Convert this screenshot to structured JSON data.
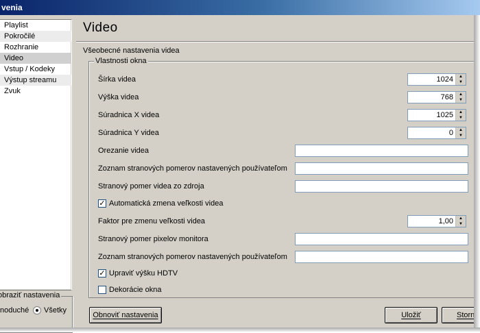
{
  "window": {
    "title": "venia"
  },
  "categories": [
    {
      "label": "Playlist"
    },
    {
      "label": "Pokročilé"
    },
    {
      "label": "Rozhranie"
    },
    {
      "label": "Video"
    },
    {
      "label": "Vstup / Kodeky"
    },
    {
      "label": "Výstup streamu"
    },
    {
      "label": "Zvuk"
    }
  ],
  "selected_category": "Video",
  "filter": {
    "legend": "obraziť nastavenia",
    "simple_label": "noduché",
    "all_label": "Všetky",
    "selected": "Všetky"
  },
  "panel": {
    "title": "Video",
    "section": "Všeobecné nastavenia videa",
    "group_title": "Vlastnosti okna"
  },
  "settings": {
    "width": {
      "label": "Šírka videa",
      "value": "1024"
    },
    "height": {
      "label": "Výška videa",
      "value": "768"
    },
    "x": {
      "label": "Súradnica X videa",
      "value": "1025"
    },
    "y": {
      "label": "Súradnica Y videa",
      "value": "0"
    },
    "crop": {
      "label": "Orezanie videa",
      "value": ""
    },
    "user_aspect_list": {
      "label": "Zoznam stranových pomerov nastavených používateľom",
      "value": ""
    },
    "source_aspect": {
      "label": "Stranový pomer videa zo zdroja",
      "value": ""
    },
    "autoscale": {
      "label": "Automatická zmena veľkosti videa",
      "checked": true
    },
    "scale_factor": {
      "label": "Faktor pre zmenu veľkosti videa",
      "value": "1,00"
    },
    "monitor_pixel_aspect": {
      "label": "Stranový pomer pixelov monitora",
      "value": ""
    },
    "user_crop_list": {
      "label": "Zoznam stranových pomerov nastavených používateľom",
      "value": ""
    },
    "hdtv": {
      "label": "Upraviť výšku HDTV",
      "checked": true
    },
    "decorations": {
      "label": "Dekorácie okna",
      "checked": false
    }
  },
  "buttons": {
    "reset": "Obnoviť nastavenia",
    "save": "Uložiť",
    "cancel": "Storn"
  }
}
